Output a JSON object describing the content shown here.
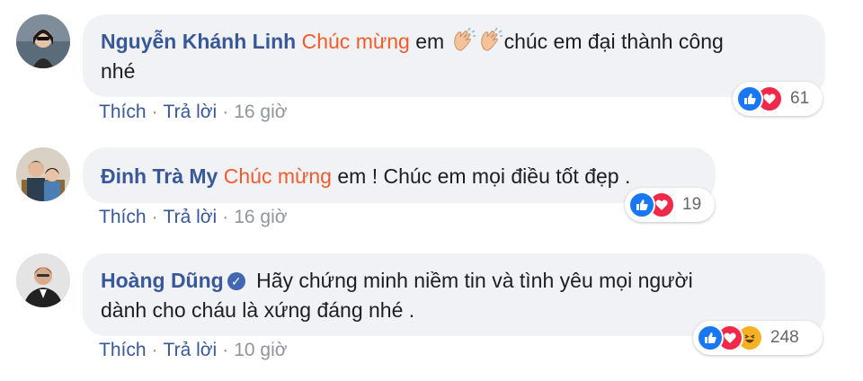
{
  "comments": [
    {
      "author": "Nguyễn Khánh Linh",
      "highlight": "Chúc mừng",
      "text_before": " em ",
      "text_after": "chúc em đại thành công",
      "text_line2": "nhé",
      "actions": {
        "like": "Thích",
        "reply": "Trả lời",
        "time": "16 giờ"
      },
      "reactions": {
        "icons": [
          "like-icon",
          "love-icon"
        ],
        "count": "61"
      }
    },
    {
      "author": "Đinh Trà My",
      "highlight": "Chúc mừng",
      "text": " em ! Chúc em mọi điều tốt đẹp .",
      "actions": {
        "like": "Thích",
        "reply": "Trả lời",
        "time": "16 giờ"
      },
      "reactions": {
        "icons": [
          "like-icon",
          "love-icon"
        ],
        "count": "19"
      }
    },
    {
      "author": "Hoàng Dũng",
      "verified_icon": "verified-badge-icon",
      "text_line1": "Hãy chứng minh niềm tin và tình yêu mọi người",
      "text_line2": "dành cho cháu là xứng đáng nhé .",
      "actions": {
        "like": "Thích",
        "reply": "Trả lời",
        "time": "10 giờ"
      },
      "reactions": {
        "icons": [
          "like-icon",
          "love-icon",
          "haha-icon"
        ],
        "count": "248"
      }
    }
  ],
  "separator": "·",
  "colors": {
    "author": "#385898",
    "highlight": "#f25c2b",
    "bubble": "#f0f2f5",
    "like": "#1877f2",
    "love": "#f02849",
    "haha": "#f7b125",
    "muted": "#90949c"
  }
}
